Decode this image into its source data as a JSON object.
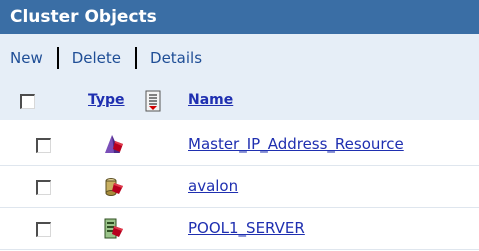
{
  "panel": {
    "title": "Cluster Objects"
  },
  "toolbar": {
    "new_label": "New",
    "delete_label": "Delete",
    "details_label": "Details"
  },
  "table": {
    "columns": [
      {
        "label": "Type"
      },
      {
        "label": "Name"
      }
    ],
    "rows": [
      {
        "icon": "cluster-resource-icon",
        "name": "Master_IP_Address_Resource"
      },
      {
        "icon": "volume-resource-icon",
        "name": "avalon"
      },
      {
        "icon": "server-resource-icon",
        "name": "POOL1_SERVER"
      }
    ]
  },
  "colors": {
    "title_bg": "#3a6ea5",
    "toolbar_bg": "#e6eef7",
    "link": "#1f2fb0"
  }
}
